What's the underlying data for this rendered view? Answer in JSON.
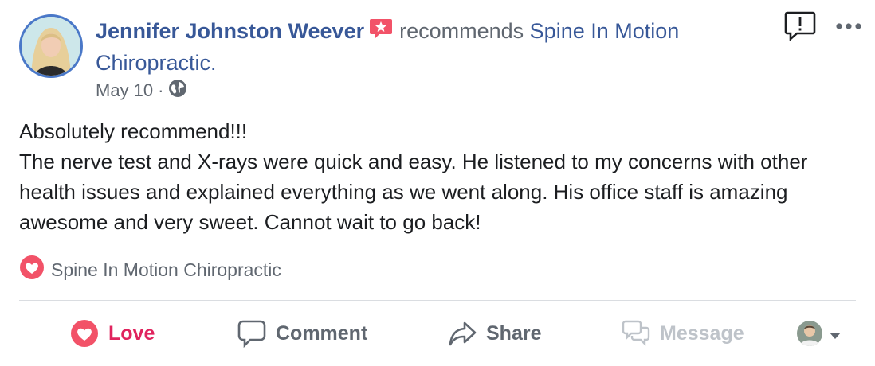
{
  "post": {
    "author": "Jennifer Johnston Weever",
    "verb": "recommends",
    "page": "Spine In Motion Chiropractic.",
    "date": "May 10",
    "separator": "·",
    "privacy_icon": "globe-icon",
    "body_lines": [
      "Absolutely recommend!!!",
      "The nerve test and X-rays were quick and easy. He listened to my concerns with other health issues and explained everything as we went along. His office staff is amazing awesome and very sweet. Cannot wait to go back!"
    ]
  },
  "top_actions": {
    "report_icon": "report-icon",
    "more_icon": "more-options-icon"
  },
  "reactions": {
    "icon": "heart-icon",
    "label": "Spine In Motion Chiropractic"
  },
  "actions": {
    "love": "Love",
    "comment": "Comment",
    "share": "Share",
    "message": "Message"
  },
  "colors": {
    "link": "#385898",
    "muted": "#606770",
    "love": "#e0245e",
    "disabled": "#bec3c9",
    "divider": "#dadde1"
  }
}
